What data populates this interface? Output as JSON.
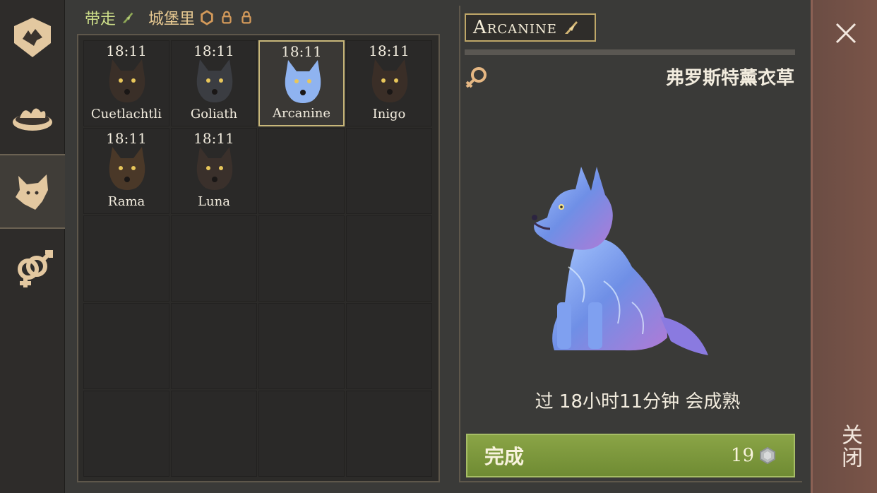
{
  "sidebar": {
    "items": [
      {
        "name": "castle-icon",
        "active": false
      },
      {
        "name": "food-bowl-icon",
        "active": false
      },
      {
        "name": "wolf-head-icon",
        "active": true
      },
      {
        "name": "breeding-gender-icon",
        "active": false
      }
    ]
  },
  "tabs": {
    "carry_label": "带走",
    "castle_label": "城堡里"
  },
  "animals": [
    {
      "time": "18:11",
      "name": "Cuetlachtli",
      "color": "#3a2f28"
    },
    {
      "time": "18:11",
      "name": "Goliath",
      "color": "#3b3d42"
    },
    {
      "time": "18:11",
      "name": "Arcanine",
      "color": "#8fb3f0",
      "selected": true
    },
    {
      "time": "18:11",
      "name": "Inigo",
      "color": "#3a2e27"
    },
    {
      "time": "18:11",
      "name": "Rama",
      "color": "#4a3828"
    },
    {
      "time": "18:11",
      "name": "Luna",
      "color": "#3a302b"
    }
  ],
  "detail": {
    "title": "Arcanine",
    "variety": "弗罗斯特薰衣草",
    "gender": "female-icon",
    "mature_text": "过 18小时11分钟 会成熟",
    "finish_label": "完成",
    "finish_cost": "19",
    "cost_icon": "gem-icon"
  },
  "close": {
    "label": "关闭"
  },
  "colors": {
    "accent_gold": "#bfa768",
    "finish_green": "#7d9a3c",
    "close_red": "#6f4f45"
  }
}
